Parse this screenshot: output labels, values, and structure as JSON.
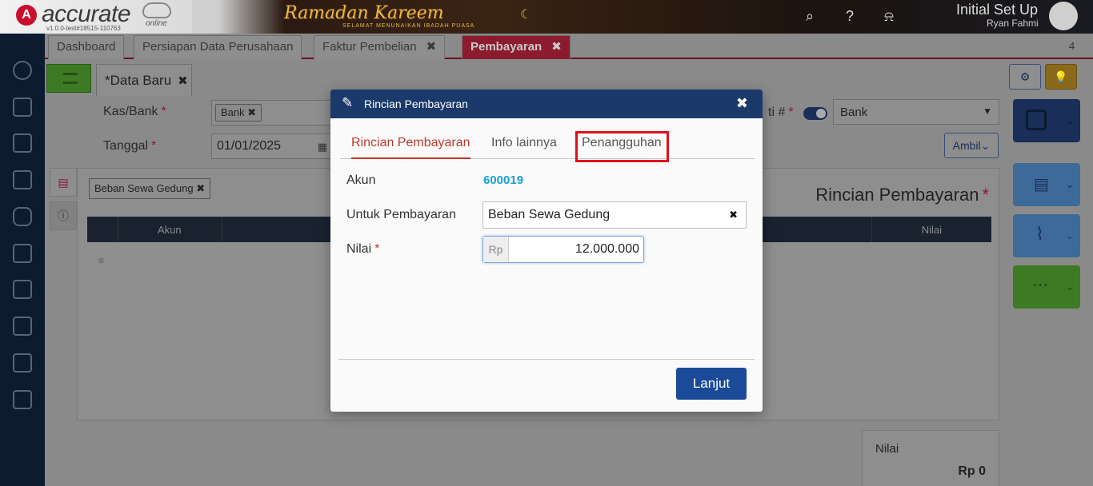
{
  "header": {
    "logo": "accurate",
    "logo_sub": "online",
    "version": "v1.0.0-test#18515-110763",
    "banner": "Ramadan Kareem",
    "banner_sub": "SELAMAT MENUNAIKAN IBADAH PUASA",
    "icons": [
      "search-icon",
      "help-icon",
      "bell-icon"
    ],
    "user_title": "Initial Set Up",
    "user_name": "Ryan Fahmi"
  },
  "tabs": [
    {
      "label": "Dashboard"
    },
    {
      "label": "Persiapan Data Perusahaan"
    },
    {
      "label": "Faktur Pembelian",
      "close": "✖"
    },
    {
      "label": "Pembayaran",
      "close": "✖",
      "active": true
    }
  ],
  "tab_count": "4",
  "sidebar_icons": [
    "settings-icon",
    "building-icon",
    "book-icon",
    "bank-icon",
    "money-bag-icon",
    "cart-icon",
    "shop-icon",
    "factory-icon",
    "tax-icon",
    "report-icon"
  ],
  "form": {
    "doc_tab": "*Data Baru",
    "doc_tab_close": "✖",
    "kas_bank_label": "Kas/Bank",
    "kas_bank_chip": "Bank",
    "tanggal_label": "Tanggal",
    "tanggal_value": "01/01/2025",
    "bukti_label": "ti #",
    "bukti_select": "Bank",
    "ambil_label": "Ambil",
    "required_mark": "*",
    "chip_close": "✖"
  },
  "panel": {
    "chip": "Beban Sewa Gedung",
    "title": "Rincian Pembayaran",
    "columns": [
      "Akun",
      "Nilai"
    ]
  },
  "total": {
    "label": "Nilai",
    "value": "Rp 0"
  },
  "modal": {
    "title": "Rincian Pembayaran",
    "close": "✖",
    "tabs": [
      "Rincian Pembayaran",
      "Info lainnya",
      "Penangguhan"
    ],
    "akun_label": "Akun",
    "akun_value": "600019",
    "untuk_label": "Untuk Pembayaran",
    "untuk_value": "Beban Sewa Gedung",
    "clear_glyph": "✖",
    "nilai_label": "Nilai",
    "nilai_prefix": "Rp",
    "nilai_value": "12.000.000",
    "required_mark": "*",
    "submit_label": "Lanjut"
  },
  "colors": {
    "brand_red": "#c8102e",
    "accent_blue": "#1b3a6b",
    "link_blue": "#1aa0d8",
    "highlight": "#e0101e"
  }
}
